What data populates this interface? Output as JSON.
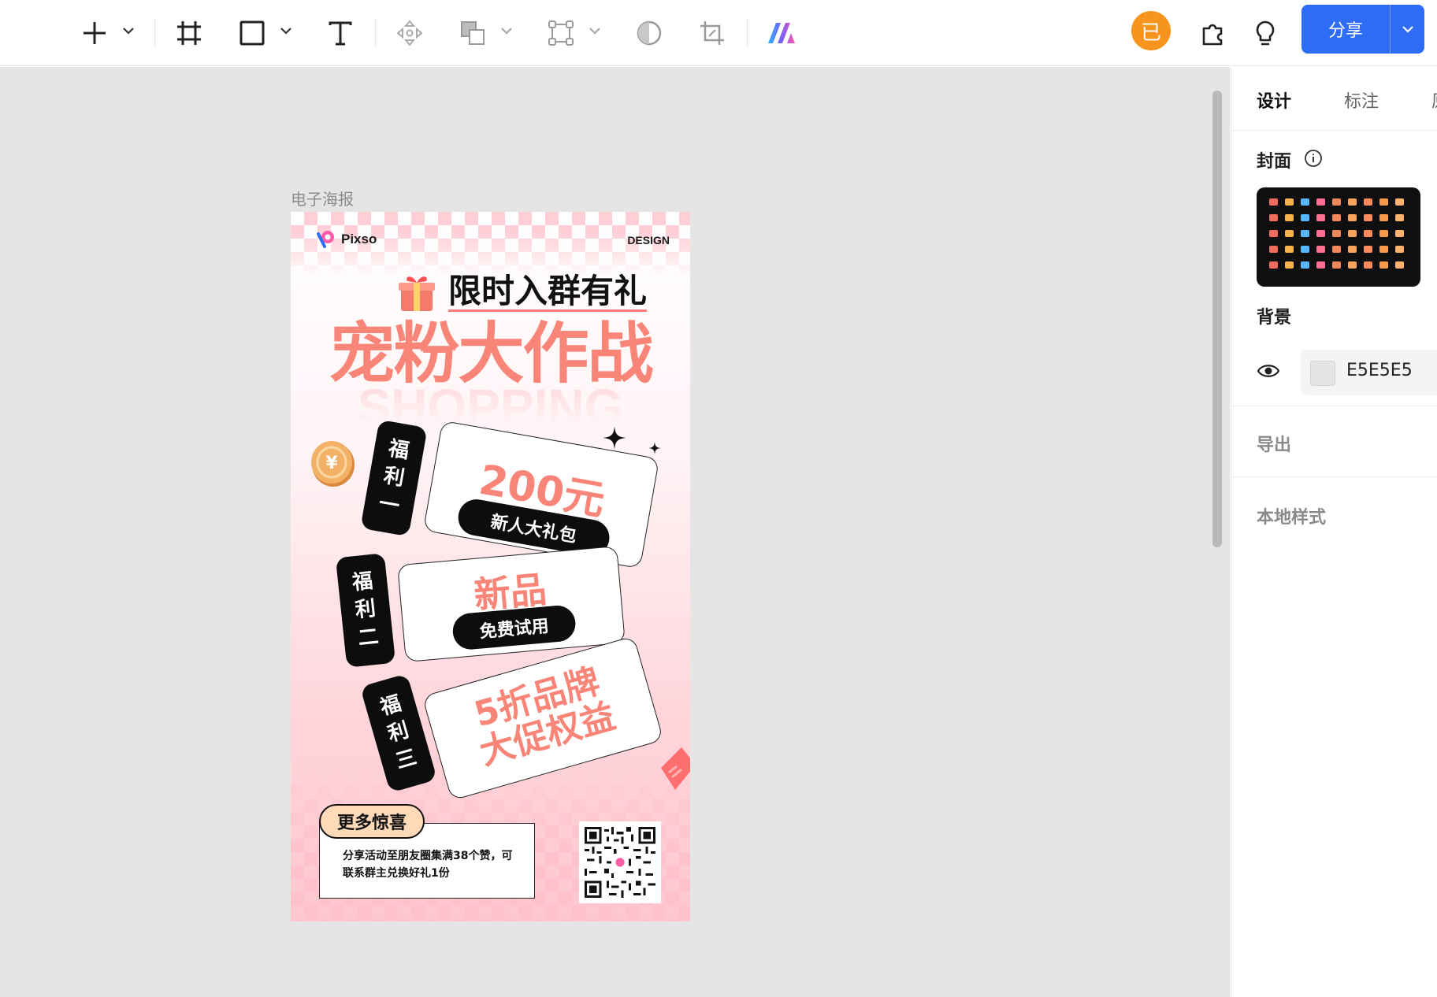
{
  "toolbar": {
    "tools": [
      {
        "name": "add-tool",
        "icon": "plus-icon",
        "has_menu": true
      },
      {
        "name": "frame-tool",
        "icon": "frame-icon",
        "has_menu": false
      },
      {
        "name": "shape-tool",
        "icon": "rectangle-icon",
        "has_menu": true
      },
      {
        "name": "text-tool",
        "icon": "text-icon",
        "has_menu": false
      },
      {
        "name": "component-tool",
        "icon": "move-icon",
        "has_menu": false
      },
      {
        "name": "boolean-tool",
        "icon": "boolean-icon",
        "has_menu": true
      },
      {
        "name": "vector-tool",
        "icon": "vector-icon",
        "has_menu": true
      },
      {
        "name": "mask-tool",
        "icon": "contrast-icon",
        "has_menu": false
      },
      {
        "name": "crop-tool",
        "icon": "crop-icon",
        "has_menu": false
      },
      {
        "name": "ai-tool",
        "icon": "ai-logo-icon",
        "has_menu": false
      }
    ],
    "avatar_text": "已",
    "share_label": "分享",
    "accent": "#2f6cf6",
    "avatar_color": "#f7941d"
  },
  "canvas": {
    "background": "#e5e5e5",
    "frame_label": "电子海报"
  },
  "poster": {
    "brand_name": "Pixso",
    "design_tag": "DESIGN",
    "subhead": "限时入群有礼",
    "headline": "宠粉大作战",
    "watermark": "SHOPPING",
    "benefits": [
      {
        "tag": [
          "福",
          "利",
          "一"
        ],
        "title": "200元",
        "pill": "新人大礼包"
      },
      {
        "tag": [
          "福",
          "利",
          "二"
        ],
        "title": "新品",
        "pill": "免费试用"
      },
      {
        "tag": [
          "福",
          "利",
          "三"
        ],
        "title_lines": [
          "5折品牌",
          "大促权益"
        ]
      }
    ],
    "more_badge": "更多惊喜",
    "more_text": "分享活动至朋友圈集满38个赞，可联系群主兑换好礼1份",
    "accent_color": "#f88577"
  },
  "panel": {
    "tabs": [
      "设计",
      "标注",
      "原"
    ],
    "cover_label": "封面",
    "background_label": "背景",
    "background_hex": "E5E5E5",
    "export_label": "导出",
    "local_styles_label": "本地样式"
  }
}
